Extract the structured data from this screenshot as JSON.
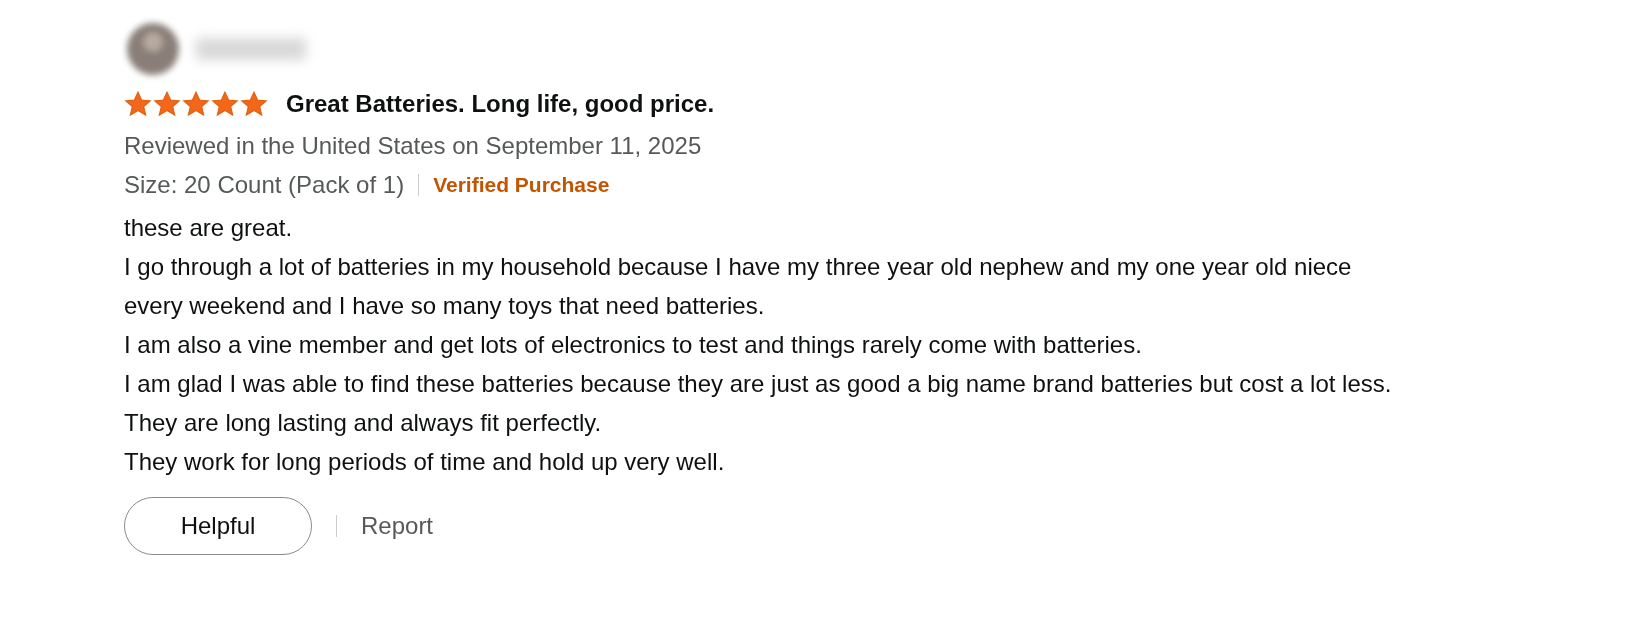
{
  "review": {
    "stars": 5,
    "title": "Great Batteries. Long life, good price.",
    "meta": "Reviewed in the United States on September 11, 2025",
    "size": "Size: 20 Count (Pack of 1)",
    "badge": "Verified Purchase",
    "body": [
      "these are great.",
      "I go through a lot of batteries in my household because I have my three year old nephew and my one year old niece every weekend and I have so many toys that need batteries.",
      "I am also a vine member and get lots of electronics to test and things rarely come with batteries.",
      "I am glad I was able to find these batteries because they are just as good a big name brand batteries but cost a lot less.",
      "They are long lasting and always fit perfectly.",
      "They work for long periods of time and hold up very well."
    ]
  },
  "actions": {
    "helpful": "Helpful",
    "report": "Report"
  }
}
